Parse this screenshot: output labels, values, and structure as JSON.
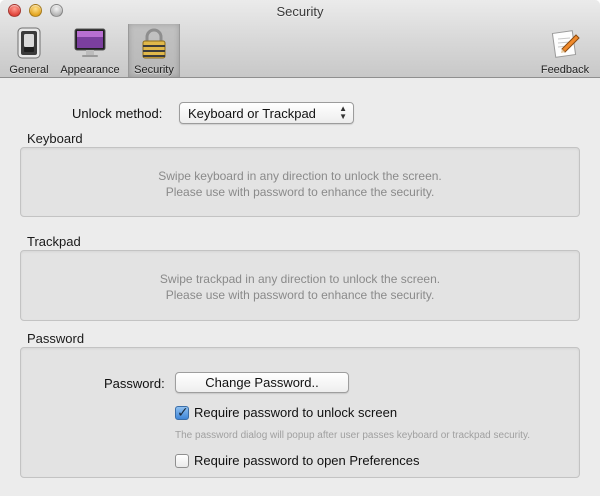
{
  "window": {
    "title": "Security"
  },
  "toolbar": {
    "items": [
      {
        "label": "General",
        "icon": "general-switch-icon"
      },
      {
        "label": "Appearance",
        "icon": "display-icon"
      },
      {
        "label": "Security",
        "icon": "lock-icon",
        "selected": true
      },
      {
        "label": "Feedback",
        "icon": "feedback-pencil-icon"
      }
    ]
  },
  "unlock": {
    "label": "Unlock method:",
    "selected": "Keyboard or Trackpad"
  },
  "keyboard": {
    "title": "Keyboard",
    "line1": "Swipe keyboard in any direction to unlock the screen.",
    "line2": "Please use with password to enhance the security."
  },
  "trackpad": {
    "title": "Trackpad",
    "line1": "Swipe trackpad in any direction to unlock the screen.",
    "line2": "Please use with password to enhance the security."
  },
  "password": {
    "title": "Password",
    "label": "Password:",
    "change_button": "Change Password..",
    "require_unlock": {
      "label": "Require password to unlock screen",
      "checked": true
    },
    "hint": "The password dialog will popup after user passes keyboard or trackpad security.",
    "require_prefs": {
      "label": "Require password to open Preferences",
      "checked": false
    }
  },
  "colors": {
    "accent_check": "#3f86d8",
    "hint_text": "#a0a0a0",
    "close": "#e0443a",
    "minimize": "#e3a521"
  }
}
